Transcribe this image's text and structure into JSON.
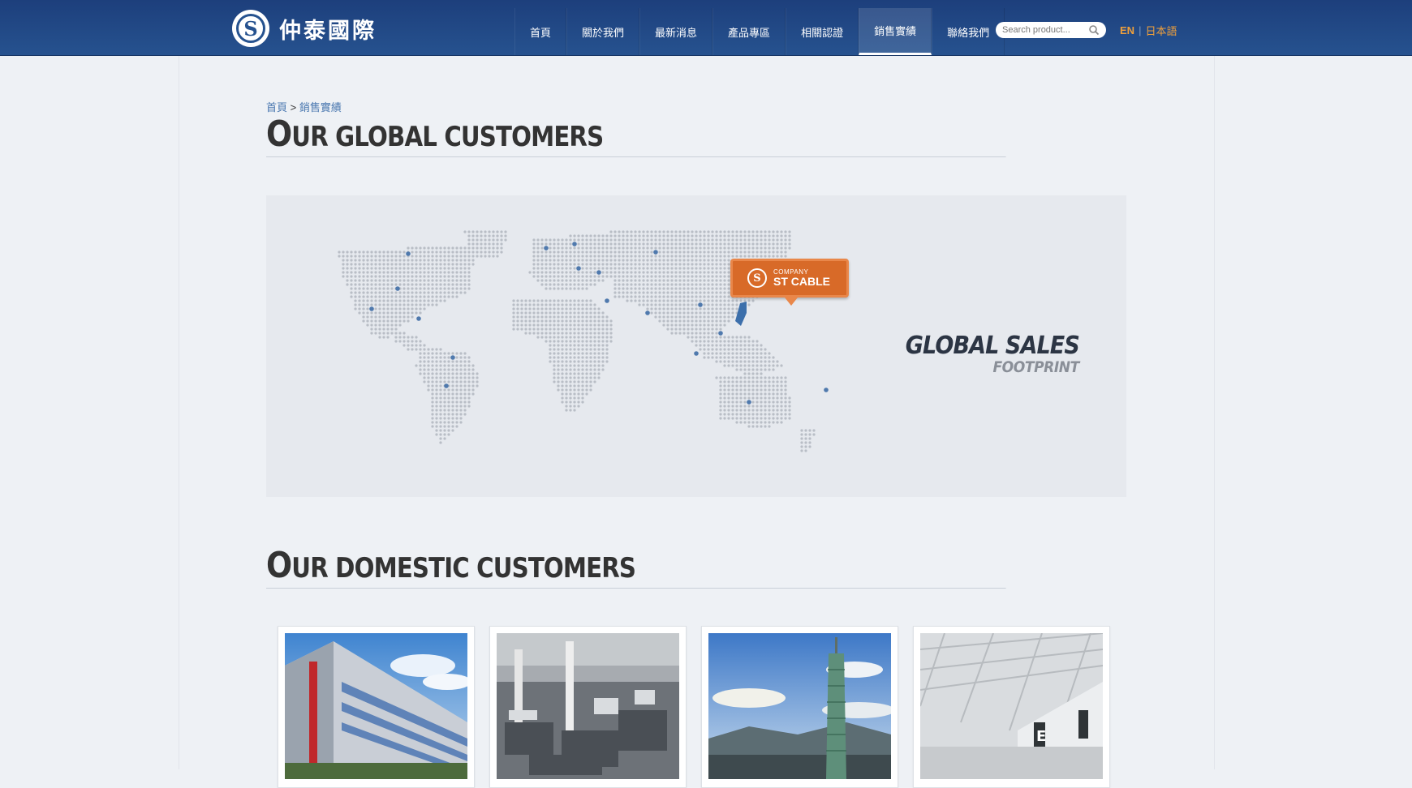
{
  "header": {
    "logo_text": "仲泰國際",
    "nav": [
      {
        "label": "首頁"
      },
      {
        "label": "關於我們"
      },
      {
        "label": "最新消息"
      },
      {
        "label": "產品專區"
      },
      {
        "label": "相關認證"
      },
      {
        "label": "銷售實績",
        "active": true
      },
      {
        "label": "聯絡我們"
      }
    ],
    "search": {
      "placeholder": "Search product..."
    },
    "lang": {
      "en": "EN",
      "jp": "日本語"
    }
  },
  "breadcrumb": {
    "home": "首頁",
    "separator": " > ",
    "current": "銷售實績"
  },
  "global_section": {
    "title_cap": "O",
    "title_rest": "UR GLOBAL CUSTOMERS",
    "map": {
      "pin_small": "COMPANY",
      "pin_big": "ST CABLE",
      "headline_1": "GLOBAL SALES",
      "headline_2": "FOOTPRINT"
    }
  },
  "domestic_section": {
    "title_cap": "O",
    "title_rest": "UR DOMESTIC CUSTOMERS"
  },
  "cards": [
    {
      "photo": "office-building"
    },
    {
      "photo": "power-plant"
    },
    {
      "photo": "taipei-101-tower"
    },
    {
      "photo": "airport-terminal"
    }
  ],
  "colors": {
    "header_blue": "#26528f",
    "accent_orange": "#d86a28",
    "lang_orange": "#f0a03b",
    "link_blue": "#4a78b0"
  }
}
